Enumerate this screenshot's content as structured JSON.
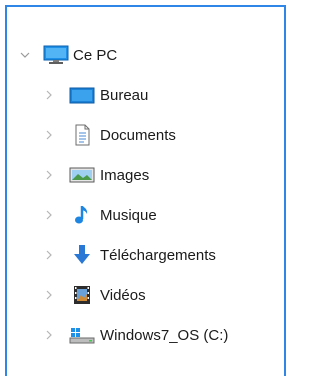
{
  "tree": {
    "root": {
      "label": "Ce PC",
      "icon": "monitor-icon"
    },
    "items": [
      {
        "label": "Bureau",
        "icon": "desktop-folder-icon"
      },
      {
        "label": "Documents",
        "icon": "documents-folder-icon"
      },
      {
        "label": "Images",
        "icon": "pictures-folder-icon"
      },
      {
        "label": "Musique",
        "icon": "music-note-icon"
      },
      {
        "label": "Téléchargements",
        "icon": "download-arrow-icon"
      },
      {
        "label": "Vidéos",
        "icon": "videos-folder-icon"
      },
      {
        "label": "Windows7_OS (C:)",
        "icon": "drive-icon"
      }
    ]
  }
}
